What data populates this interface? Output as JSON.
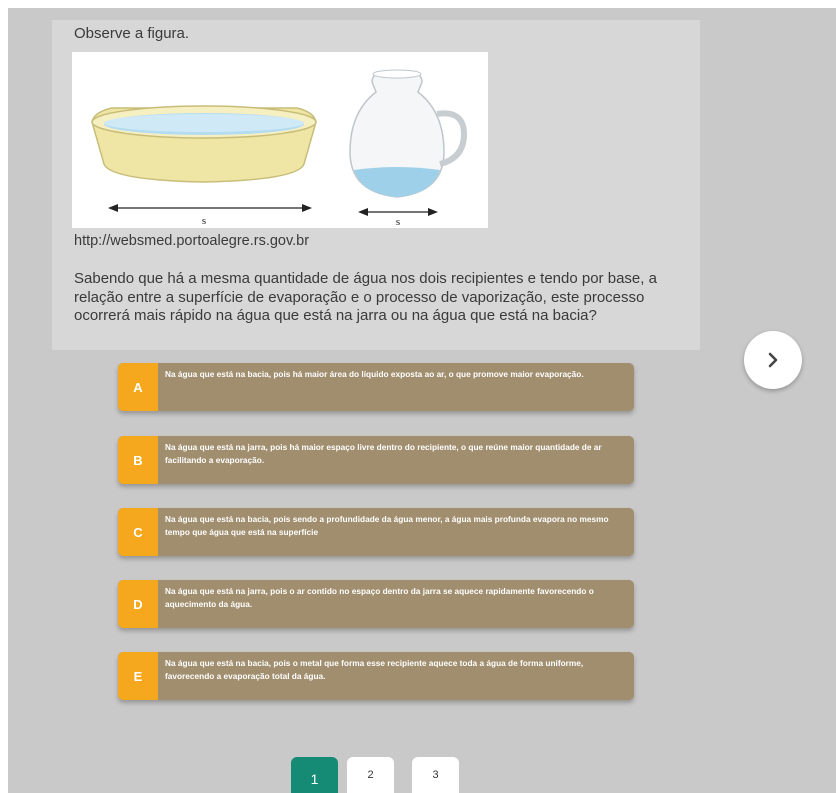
{
  "question": {
    "intro": "Observe a figura.",
    "figure": {
      "basin_label": "s",
      "jar_label": "s"
    },
    "source": "http://websmed.portoalegre.rs.gov.br",
    "text": "Sabendo que há a mesma quantidade de água nos dois recipientes e tendo por base, a relação entre a superfície de evaporação e o processo de vaporização, este processo ocorrerá mais rápido na água que está na jarra ou na água que está na bacia?"
  },
  "options": [
    {
      "letter": "A",
      "text": "Na água que está na bacia, pois há maior área do líquido exposta ao ar, o que promove maior evaporação."
    },
    {
      "letter": "B",
      "text": "Na água que está na jarra, pois há maior espaço livre dentro do recipiente, o que reúne maior quantidade de ar facilitando a evaporação."
    },
    {
      "letter": "C",
      "text": "Na água que está na bacia, pois sendo a profundidade da água menor, a água mais profunda evapora no mesmo tempo que água que está na superfície"
    },
    {
      "letter": "D",
      "text": "Na água que está na jarra, pois o ar contido no espaço dentro da jarra se aquece rapidamente favorecendo o aquecimento da água."
    },
    {
      "letter": "E",
      "text": "Na água que está na bacia, pois o metal que forma esse recipiente aquece toda a água de forma uniforme, favorecendo a evaporação total da água."
    }
  ],
  "navigation": {
    "next_icon": "chevron-right-icon",
    "pages": [
      "1",
      "2",
      "3"
    ],
    "current_page": "1"
  },
  "colors": {
    "option_background": "#a08e6e",
    "option_letter": "#f5a81e",
    "active_page": "#158a74",
    "basin": "#efe6a6",
    "water": "#9fd0ea"
  }
}
